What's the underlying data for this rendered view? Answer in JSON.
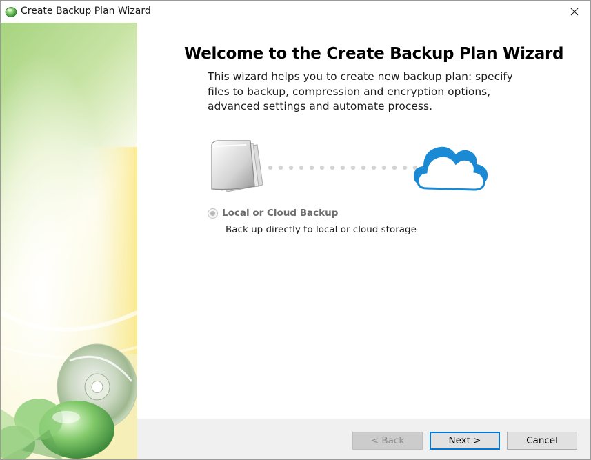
{
  "window": {
    "title": "Create Backup Plan Wizard",
    "icon": "green-gem-icon",
    "close_icon": "close-icon"
  },
  "content": {
    "heading": "Welcome to the Create Backup Plan Wizard",
    "description": "This wizard helps you to create new backup plan: specify files to backup, compression and encryption options, advanced settings and automate process.",
    "illustration": {
      "source_icon": "files-stack-icon",
      "target_icon": "cloud-icon"
    },
    "options": [
      {
        "label": "Local or Cloud Backup",
        "description": "Back up directly to local or cloud storage",
        "selected": true
      }
    ]
  },
  "footer": {
    "back_label": "< Back",
    "next_label": "Next >",
    "cancel_label": "Cancel"
  },
  "colors": {
    "accent": "#0078d7",
    "cloud": "#1a8ad4",
    "side_green": "#9fd17a",
    "side_yellow": "#fff3a6"
  }
}
